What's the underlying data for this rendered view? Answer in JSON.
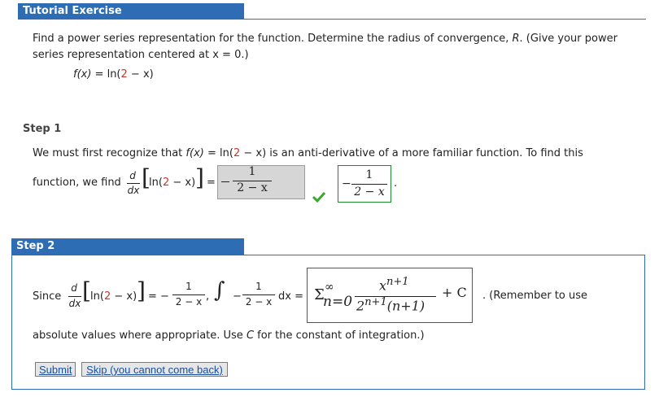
{
  "header": {
    "title": "Tutorial Exercise"
  },
  "problem": {
    "text_line1": "Find a power series representation for the function. Determine the radius of convergence, ",
    "R": "R",
    "text_line1_end": ". (Give your power",
    "text_line2": "series representation centered at x = 0.)",
    "fx": "f(x)",
    "eq": " = ln(",
    "two": "2",
    "minus_x": " − x)"
  },
  "step1": {
    "label": "Step 1",
    "line1_a": "We must first recognize that ",
    "line1_fx": "f(x)",
    "line1_b": " = ln(",
    "line1_two": "2",
    "line1_c": " − x) is an anti-derivative of a more familiar function. To find this",
    "line2_a": "function, we find",
    "d": "d",
    "dx": "dx",
    "ln_open": "ln(",
    "ln_two": "2",
    "ln_close": " − x)",
    "equals": "=",
    "input_num": "1",
    "input_den": "2 − x",
    "answer_num": "1",
    "answer_den": "2 − x",
    "answer_sign": "−",
    "period": "."
  },
  "step2": {
    "label": "Step 2",
    "since": "Since",
    "d": "d",
    "dx": "dx",
    "ln_open": "ln(",
    "ln_two": "2",
    "ln_close": " − x)",
    "eq1": "= −",
    "frac_num": "1",
    "frac_den": "2 − x",
    "comma": ",",
    "integral": "∫",
    "minus": "−",
    "int_num": "1",
    "int_den": "2 − x",
    "int_dx": "dx =",
    "sum_prefix": "Σ",
    "sum_top": "∞",
    "sum_bottom": "n=0",
    "ans_num": "x",
    "ans_num_exp": "n+1",
    "ans_den": "2",
    "ans_den_exp": "n+1",
    "ans_den_rest": "(n+1)",
    "plus_c": "+ C",
    "remember": ". (Remember to use",
    "line2": "absolute values where appropriate. Use ",
    "C": "C",
    "line2_end": " for the constant of integration.)",
    "submit": "Submit",
    "skip": "Skip (you cannot come back)"
  },
  "colors": {
    "accent": "#2e6db4",
    "check": "#3aa832",
    "red": "#c0392b"
  }
}
